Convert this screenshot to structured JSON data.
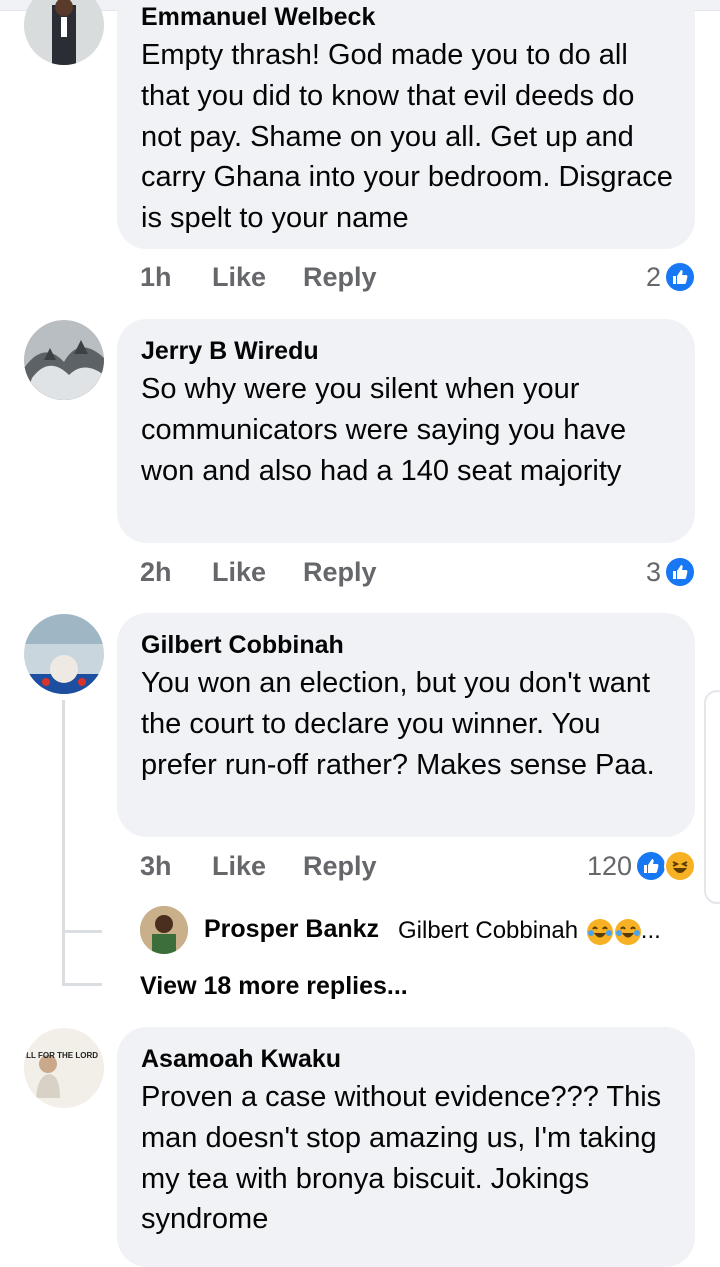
{
  "comments": [
    {
      "author": "Emmanuel Welbeck",
      "text": "Empty thrash! God made you to do all that you did to know that evil deeds do not pay. Shame on you all. Get up and carry Ghana into your bedroom. Disgrace is spelt to your name",
      "time": "1h",
      "like_label": "Like",
      "reply_label": "Reply",
      "reaction_count": "2"
    },
    {
      "author": "Jerry B Wiredu",
      "text": "So why were you silent when your communicators were saying you have won and also had a 140 seat majority",
      "time": "2h",
      "like_label": "Like",
      "reply_label": "Reply",
      "reaction_count": "3"
    },
    {
      "author": "Gilbert Cobbinah",
      "text": "You won an election, but you don't want the court to declare you winner. You prefer run-off rather? Makes sense Paa.",
      "time": "3h",
      "like_label": "Like",
      "reply_label": "Reply",
      "reaction_count": "120"
    },
    {
      "author": "Asamoah Kwaku",
      "text": "Proven a case without evidence??? This man doesn't stop amazing us, I'm taking my tea with bronya biscuit. Jokings syndrome"
    }
  ],
  "reply_preview": {
    "author": "Prosper Bankz",
    "snippet": "Gilbert Cobbinah",
    "ellipsis": "..."
  },
  "view_more_label": "View 18 more replies...",
  "avatar_text": {
    "asamoah": "NO PRAYER IS TOO SMALL FOR THE LORD"
  },
  "colors": {
    "bubble": "#f0f2f5",
    "meta": "#65676b",
    "like_blue": "#1877f2",
    "haha_yellow": "#f7b125"
  },
  "icons": [
    "like-icon",
    "haha-icon"
  ]
}
